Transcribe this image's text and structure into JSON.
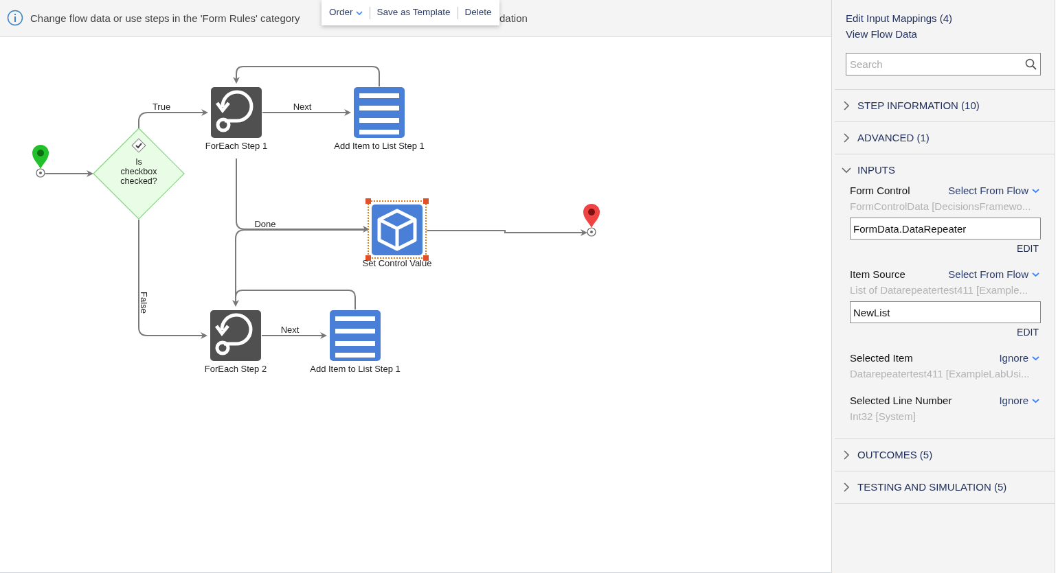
{
  "banner": {
    "text": "Change flow data or use steps in the 'Form Rules' category",
    "text_tail": "dation"
  },
  "toolbar": [
    {
      "label": "Order",
      "kind": "dropdown"
    },
    {
      "label": "Save as Template",
      "kind": "button"
    },
    {
      "label": "Delete",
      "kind": "button"
    }
  ],
  "flow": {
    "nodes": [
      {
        "kind": "start",
        "selected": false
      },
      {
        "kind": "decision",
        "label": "Is checkbox checked?",
        "selected": false
      },
      {
        "kind": "foreach",
        "label": "ForEach Step 1",
        "selected": false
      },
      {
        "kind": "list",
        "label": "Add Item to List Step 1",
        "selected": false
      },
      {
        "kind": "setcontrol",
        "label": "Set Control Value",
        "selected": true
      },
      {
        "kind": "end",
        "selected": false
      },
      {
        "kind": "foreach",
        "label": "ForEach Step 2",
        "selected": false
      },
      {
        "kind": "list",
        "label": "Add Item to List Step 1",
        "selected": false
      }
    ],
    "edge_labels": [
      "True",
      "Next",
      "Done",
      "False",
      "Next"
    ]
  },
  "panel": {
    "links": [
      "Edit Input Mappings (4)",
      "View Flow Data"
    ],
    "search": {
      "placeholder": "Search"
    },
    "sections": [
      {
        "title": "STEP INFORMATION (10)",
        "expanded": false
      },
      {
        "title": "ADVANCED (1)",
        "expanded": false
      },
      {
        "title": "INPUTS",
        "expanded": true,
        "inputs": [
          {
            "label": "Form Control",
            "mode": "Select From Flow",
            "type": "FormControlData [DecisionsFramewo...",
            "value": "FormData.DataRepeater",
            "action": "EDIT"
          },
          {
            "label": "Item Source",
            "mode": "Select From Flow",
            "type": "List of Datarepeatertest411 [Example...",
            "value": "NewList",
            "action": "EDIT"
          },
          {
            "label": "Selected Item",
            "mode": "Ignore",
            "type": "Datarepeatertest411 [ExampleLabUsi..."
          },
          {
            "label": "Selected Line Number",
            "mode": "Ignore",
            "type": "Int32 [System]"
          }
        ]
      },
      {
        "title": "OUTCOMES (5)",
        "expanded": false
      },
      {
        "title": "TESTING AND SIMULATION (5)",
        "expanded": false
      }
    ]
  }
}
